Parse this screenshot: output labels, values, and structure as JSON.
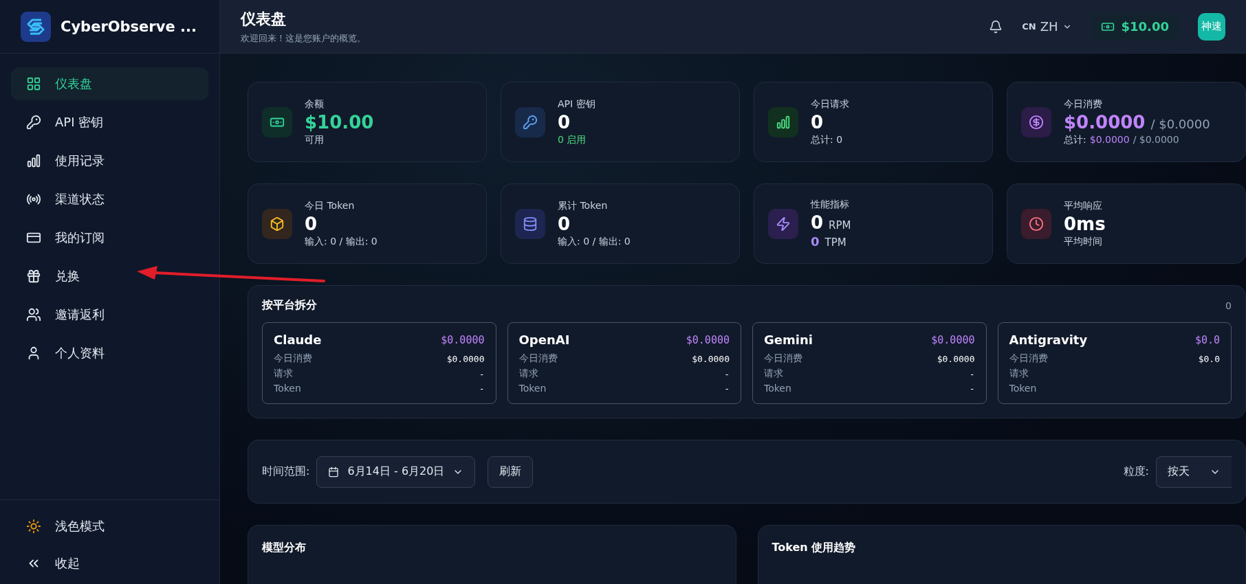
{
  "sidebar": {
    "brand": "CyberObserve ...",
    "items": [
      {
        "kind": "dashboard",
        "label": "仪表盘",
        "selected": true
      },
      {
        "kind": "key",
        "label": "API 密钥",
        "selected": false
      },
      {
        "kind": "usage",
        "label": "使用记录",
        "selected": false
      },
      {
        "kind": "signal",
        "label": "渠道状态",
        "selected": false
      },
      {
        "kind": "card",
        "label": "我的订阅",
        "selected": false
      },
      {
        "kind": "gift",
        "label": "兑换",
        "selected": false
      },
      {
        "kind": "users",
        "label": "邀请返利",
        "selected": false
      },
      {
        "kind": "user",
        "label": "个人资料",
        "selected": false
      }
    ],
    "footer": [
      {
        "kind": "theme",
        "label": "浅色模式"
      },
      {
        "kind": "collapse",
        "label": "收起"
      }
    ]
  },
  "header": {
    "title": "仪表盘",
    "subtitle": "欢迎回来！这是您账户的概览。",
    "lang_code": "CN",
    "lang": "ZH",
    "balance": "$10.00",
    "avatar": "神速"
  },
  "stats": [
    {
      "kind": "balance",
      "label": "余额",
      "value": "$10.00",
      "note": "可用"
    },
    {
      "kind": "keys",
      "label": "API 密钥",
      "value": "0",
      "note": "0 启用"
    },
    {
      "kind": "requests",
      "label": "今日请求",
      "value": "0",
      "note": "总计: 0"
    },
    {
      "kind": "cost",
      "label": "今日消费",
      "value": "$0.0000",
      "value_total": "/ $0.0000",
      "note": "总计:",
      "note_value": "$0.0000",
      "note_total": "/ $0.0000"
    },
    {
      "kind": "tokens",
      "label": "今日 Token",
      "value": "0",
      "note": "输入: 0 / 输出: 0"
    },
    {
      "kind": "total_tokens",
      "label": "累计 Token",
      "value": "0",
      "note": "输入: 0 / 输出: 0"
    },
    {
      "kind": "performance",
      "label": "性能指标",
      "value": "0",
      "unit": "RPM",
      "value2": "0",
      "unit2": "TPM"
    },
    {
      "kind": "latency",
      "label": "平均响应",
      "value": "0ms",
      "note": "平均时间"
    }
  ],
  "platforms": {
    "title": "按平台拆分",
    "count": "0",
    "items": [
      {
        "name": "Claude",
        "total": "$0.0000",
        "rows": [
          {
            "label": "今日消费",
            "value": "$0.0000"
          },
          {
            "label": "请求",
            "value": "-"
          },
          {
            "label": "Token",
            "value": "-"
          }
        ]
      },
      {
        "name": "OpenAI",
        "total": "$0.0000",
        "rows": [
          {
            "label": "今日消费",
            "value": "$0.0000"
          },
          {
            "label": "请求",
            "value": "-"
          },
          {
            "label": "Token",
            "value": "-"
          }
        ]
      },
      {
        "name": "Gemini",
        "total": "$0.0000",
        "rows": [
          {
            "label": "今日消费",
            "value": "$0.0000"
          },
          {
            "label": "请求",
            "value": "-"
          },
          {
            "label": "Token",
            "value": "-"
          }
        ]
      },
      {
        "name": "Antigravity",
        "total": "$0.0",
        "rows": [
          {
            "label": "今日消费",
            "value": "$0.0"
          },
          {
            "label": "请求"
          },
          {
            "label": "Token"
          }
        ]
      }
    ]
  },
  "filters": {
    "range_label": "时间范围:",
    "range": "6月14日 - 6月20日",
    "refresh": "刷新",
    "granularity_label": "粒度:",
    "granularity": "按天"
  },
  "panels": [
    {
      "title": "模型分布"
    },
    {
      "title": "Token 使用趋势"
    }
  ]
}
